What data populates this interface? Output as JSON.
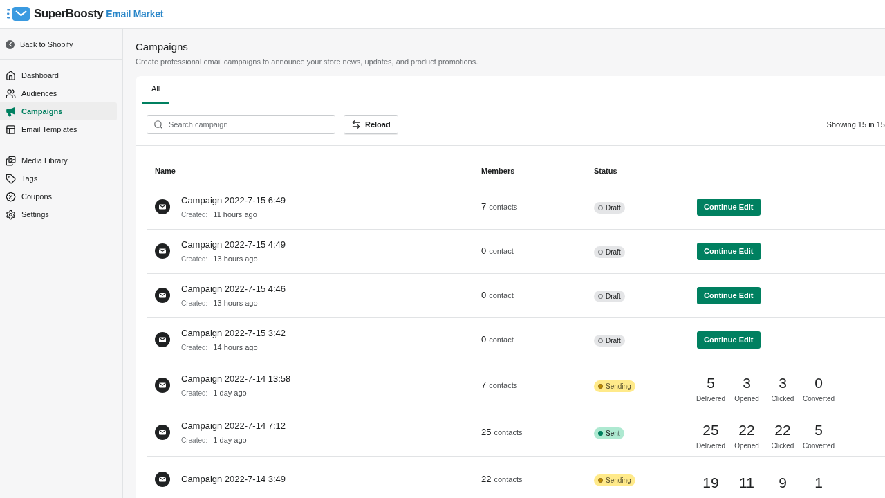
{
  "logo": {
    "brand": "SuperBoosty",
    "product": "Email Market"
  },
  "sidebar": {
    "back": "Back to Shopify",
    "groups": [
      [
        {
          "label": "Dashboard",
          "selected": false
        },
        {
          "label": "Audiences",
          "selected": false
        },
        {
          "label": "Campaigns",
          "selected": true
        },
        {
          "label": "Email Templates",
          "selected": false
        }
      ],
      [
        {
          "label": "Media Library",
          "selected": false
        },
        {
          "label": "Tags",
          "selected": false
        },
        {
          "label": "Coupons",
          "selected": false
        },
        {
          "label": "Settings",
          "selected": false
        }
      ]
    ]
  },
  "page": {
    "title": "Campaigns",
    "subtitle": "Create professional email campaigns to announce your store news, updates, and product promotions."
  },
  "tabs": [
    {
      "label": "All",
      "selected": true
    }
  ],
  "search": {
    "placeholder": "Search campaign"
  },
  "reload_button": "Reload",
  "showing": "Showing 15 in 15",
  "table": {
    "columns": [
      "Name",
      "Members",
      "Status"
    ],
    "rows": [
      {
        "name": "Campaign 2022-7-15 6:49",
        "created_label": "Created:",
        "created": "11 hours ago",
        "count": "7",
        "unit": "contacts",
        "status": {
          "kind": "draft",
          "label": "Draft"
        },
        "action": {
          "kind": "button",
          "label": "Continue Edit"
        }
      },
      {
        "name": "Campaign 2022-7-15 4:49",
        "created_label": "Created:",
        "created": "13 hours ago",
        "count": "0",
        "unit": "contact",
        "status": {
          "kind": "draft",
          "label": "Draft"
        },
        "action": {
          "kind": "button",
          "label": "Continue Edit"
        }
      },
      {
        "name": "Campaign 2022-7-15 4:46",
        "created_label": "Created:",
        "created": "13 hours ago",
        "count": "0",
        "unit": "contact",
        "status": {
          "kind": "draft",
          "label": "Draft"
        },
        "action": {
          "kind": "button",
          "label": "Continue Edit"
        }
      },
      {
        "name": "Campaign 2022-7-15 3:42",
        "created_label": "Created:",
        "created": "14 hours ago",
        "count": "0",
        "unit": "contact",
        "status": {
          "kind": "draft",
          "label": "Draft"
        },
        "action": {
          "kind": "button",
          "label": "Continue Edit"
        }
      },
      {
        "name": "Campaign 2022-7-14 13:58",
        "created_label": "Created:",
        "created": "1 day ago",
        "count": "7",
        "unit": "contacts",
        "status": {
          "kind": "sending",
          "label": "Sending"
        },
        "action": {
          "kind": "stats",
          "stats": [
            {
              "value": "5",
              "label": "Delivered"
            },
            {
              "value": "3",
              "label": "Opened"
            },
            {
              "value": "3",
              "label": "Clicked"
            },
            {
              "value": "0",
              "label": "Converted"
            }
          ]
        }
      },
      {
        "name": "Campaign 2022-7-14 7:12",
        "created_label": "Created:",
        "created": "1 day ago",
        "count": "25",
        "unit": "contacts",
        "status": {
          "kind": "sent",
          "label": "Sent"
        },
        "action": {
          "kind": "stats",
          "stats": [
            {
              "value": "25",
              "label": "Delivered"
            },
            {
              "value": "22",
              "label": "Opened"
            },
            {
              "value": "22",
              "label": "Clicked"
            },
            {
              "value": "5",
              "label": "Converted"
            }
          ]
        }
      },
      {
        "name": "Campaign 2022-7-14 3:49",
        "count": "22",
        "unit": "contacts",
        "status": {
          "kind": "sending",
          "label": "Sending"
        },
        "action": {
          "kind": "stats",
          "stats": [
            {
              "value": "19"
            },
            {
              "value": "11"
            },
            {
              "value": "9"
            },
            {
              "value": "1"
            }
          ]
        }
      }
    ]
  }
}
